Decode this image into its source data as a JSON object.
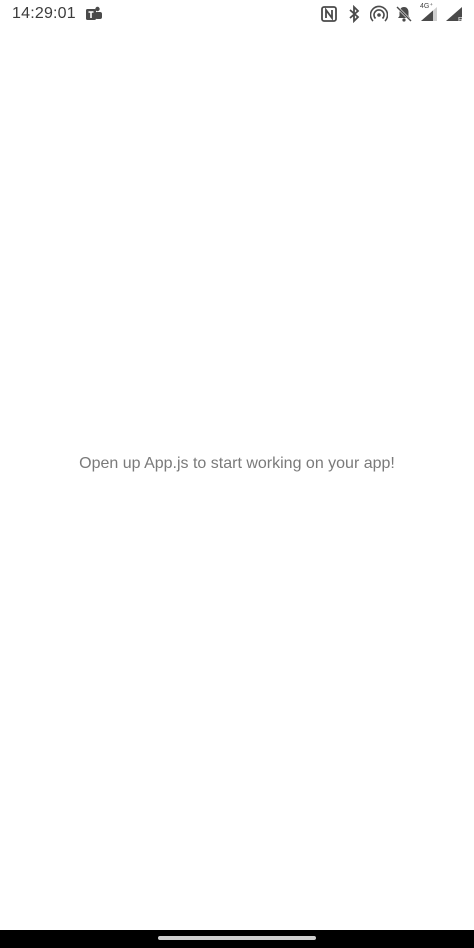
{
  "status_bar": {
    "time": "14:29:01",
    "network_label": "4G⁺",
    "roaming_label": "R",
    "icons": [
      "teams-icon",
      "nfc-icon",
      "bluetooth-icon",
      "hotspot-icon",
      "notifications-off-icon",
      "mobile-signal-icon",
      "signal-icon"
    ]
  },
  "main": {
    "message": "Open up App.js to start working on your app!"
  },
  "colors": {
    "background": "#ffffff",
    "message_text": "#7a7a7a",
    "nav_bar": "#000000"
  }
}
